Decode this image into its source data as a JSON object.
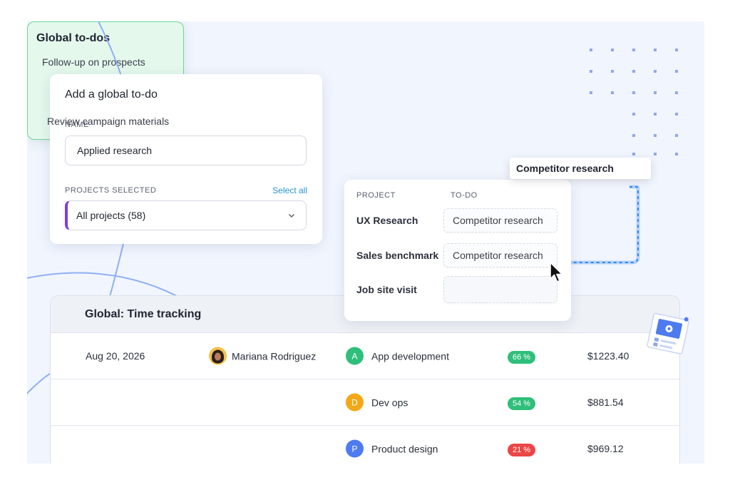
{
  "add_todo": {
    "title": "Add a global to-do",
    "name_label": "NAME",
    "name_value": "Applied research",
    "projects_label": "PROJECTS SELECTED",
    "select_all_label": "Select all",
    "projects_value": "All projects (58)"
  },
  "project_table": {
    "col_project": "PROJECT",
    "col_todo": "TO-DO",
    "rows": [
      {
        "project": "UX Research",
        "todo": "Competitor research"
      },
      {
        "project": "Sales benchmark",
        "todo": "Competitor research"
      },
      {
        "project": "Job site visit",
        "todo": ""
      }
    ]
  },
  "global_todos": {
    "title": "Global to-dos",
    "items": [
      "Follow-up on prospects",
      "Competitor research",
      "Review campaign materials"
    ]
  },
  "time_tracking": {
    "title": "Global: Time tracking",
    "rows": [
      {
        "date": "Aug 20, 2026",
        "user": "Mariana Rodriguez",
        "project_initial": "A",
        "project": "App development",
        "project_color": "#2fbf7a",
        "percent": "66 %",
        "percent_color": "#2fbf7a",
        "amount": "$1223.40"
      },
      {
        "date": "",
        "user": "",
        "project_initial": "D",
        "project": "Dev ops",
        "project_color": "#f2a818",
        "percent": "54 %",
        "percent_color": "#2fbf7a",
        "amount": "$881.54"
      },
      {
        "date": "",
        "user": "",
        "project_initial": "P",
        "project": "Product design",
        "project_color": "#4f7bf0",
        "percent": "21 %",
        "percent_color": "#ec4646",
        "amount": "$969.12"
      }
    ]
  },
  "colors": {
    "accent_purple": "#7d3ee0",
    "link_blue": "#2a93d5",
    "green_card_bg": "#e4f8ec",
    "green_card_border": "#6fd59b",
    "canvas_bg": "#f1f5fe"
  },
  "icons": [
    "chevron-down-icon",
    "cursor-pointer-icon",
    "sticky-note-icon",
    "user-avatar"
  ]
}
